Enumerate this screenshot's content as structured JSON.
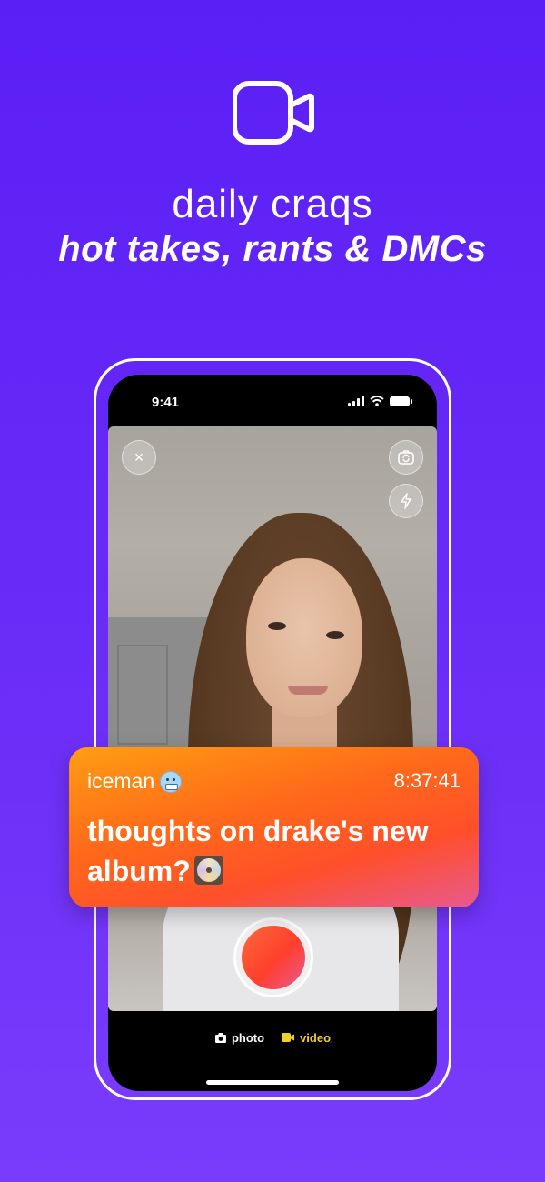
{
  "header": {
    "title_line_1": "daily craqs",
    "title_line_2": "hot takes, rants & DMCs",
    "icon": "video-camera-icon"
  },
  "phone": {
    "status_time": "9:41",
    "status_icons": [
      "signal-icon",
      "wifi-icon",
      "battery-icon"
    ],
    "camera_controls": {
      "close_icon": "×",
      "flip_icon": "camera-flip-icon",
      "flash_icon": "flash-icon"
    },
    "modes": [
      {
        "label": "photo",
        "icon": "camera-icon",
        "active": false
      },
      {
        "label": "video",
        "icon": "video-icon",
        "active": true
      }
    ]
  },
  "prompt": {
    "username": "iceman",
    "user_emoji": "cold-face-emoji",
    "time": "8:37:41",
    "question": "thoughts on drake's new album?",
    "question_emoji": "cd-emoji"
  },
  "colors": {
    "background": "#5a1ff5",
    "accent_orange": "#ff6a1a",
    "video_mode_active": "#f2d027"
  }
}
